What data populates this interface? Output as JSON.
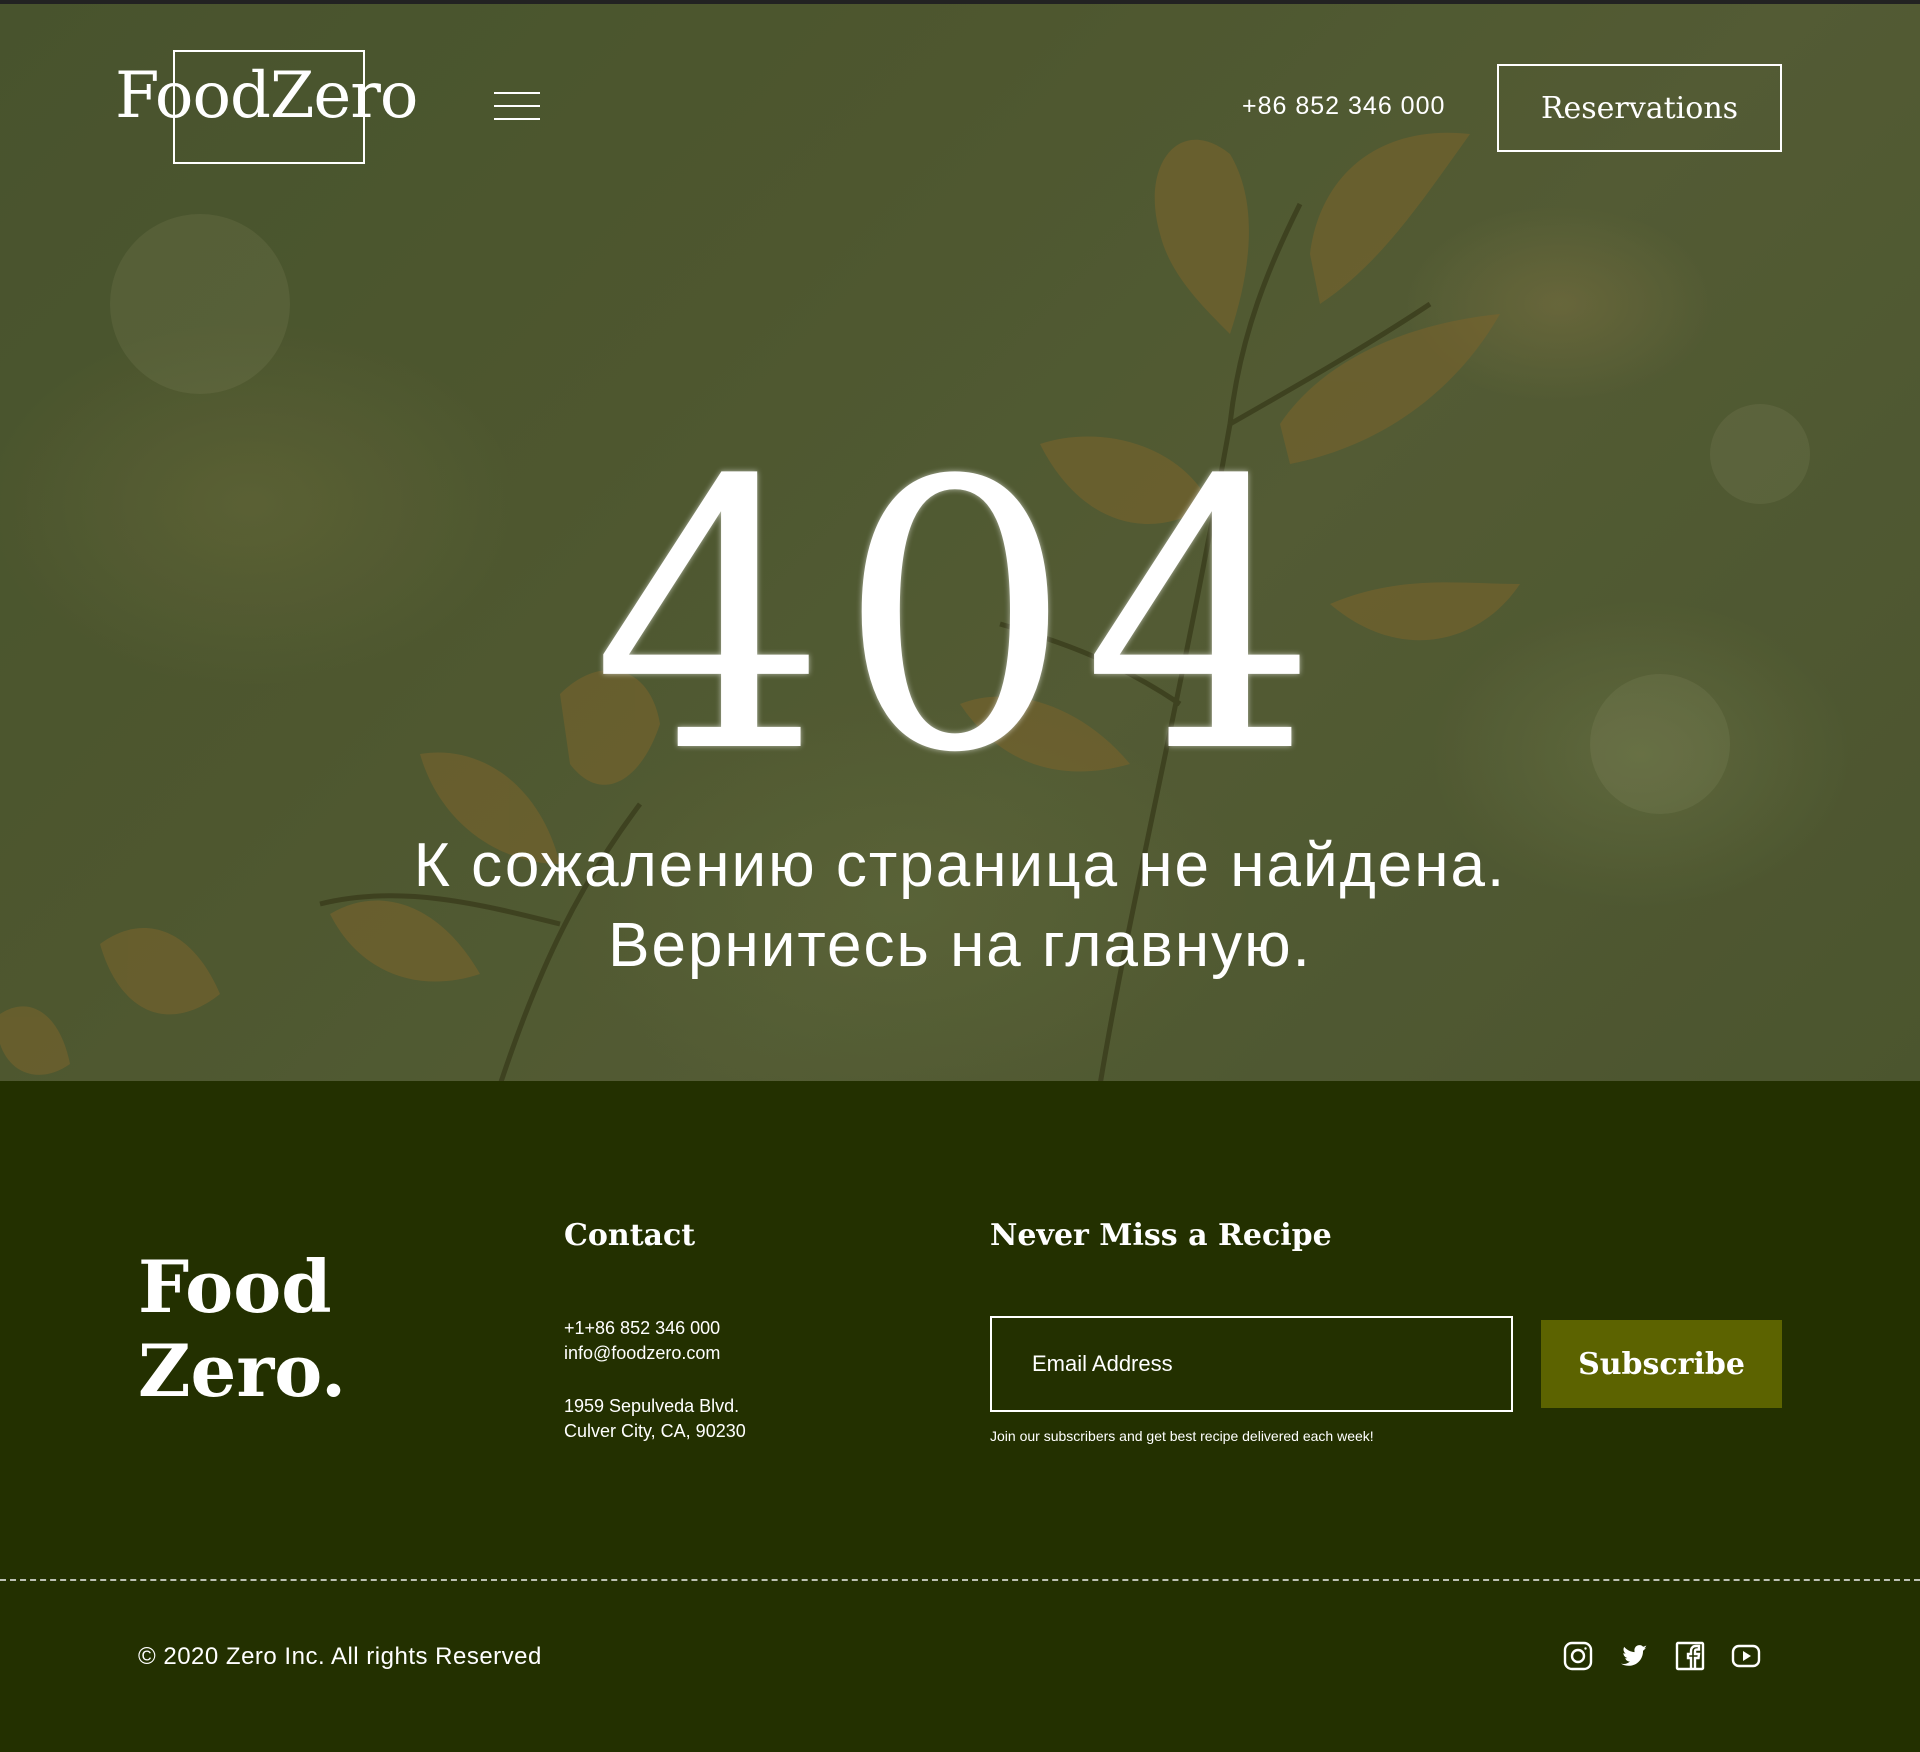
{
  "header": {
    "logo_text": "FoodZero",
    "phone": "+86 852 346 000",
    "reservations_label": "Reservations"
  },
  "hero": {
    "error_code": "404",
    "message_line1": "К сожалению страница не найдена.",
    "message_line2": "Вернитесь на главную."
  },
  "footer": {
    "logo_line1": "Food",
    "logo_line2": "Zero.",
    "contact": {
      "title": "Contact",
      "phone": "+1+86 852 346 000",
      "email": "info@foodzero.com",
      "address_line1": "1959 Sepulveda Blvd.",
      "address_line2": "Culver City, CA, 90230"
    },
    "newsletter": {
      "title": "Never Miss a Recipe",
      "email_placeholder": "Email Address",
      "subscribe_label": "Subscribe",
      "note": "Join our subscribers and get best recipe delivered each week!"
    },
    "copyright": "© 2020 Zero Inc. All rights Reserved",
    "social_icons": [
      "instagram-icon",
      "twitter-icon",
      "facebook-icon",
      "youtube-icon"
    ]
  },
  "colors": {
    "footer_bg": "#233000",
    "subscribe_bg": "#5c6300",
    "text": "#ffffff"
  }
}
